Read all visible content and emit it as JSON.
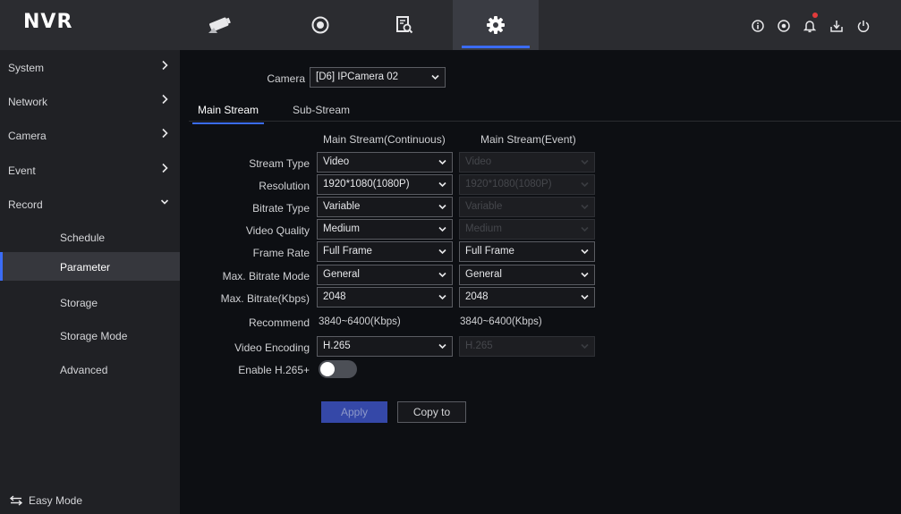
{
  "app": {
    "title": "NVR"
  },
  "topnav": {
    "tabs": [
      {
        "name": "live-view",
        "icon": "camera-icon"
      },
      {
        "name": "playback",
        "icon": "playback-icon"
      },
      {
        "name": "file-management",
        "icon": "file-search-icon"
      },
      {
        "name": "configuration",
        "icon": "gear-icon",
        "active": true
      }
    ],
    "right_icons": [
      "info-icon",
      "record-status-icon",
      "bell-icon",
      "download-icon",
      "power-icon"
    ]
  },
  "sidebar": {
    "items": [
      {
        "label": "System",
        "expandable": true
      },
      {
        "label": "Network",
        "expandable": true
      },
      {
        "label": "Camera",
        "expandable": true
      },
      {
        "label": "Event",
        "expandable": true
      },
      {
        "label": "Record",
        "expandable": true,
        "expanded": true
      },
      {
        "label": "Schedule"
      },
      {
        "label": "Parameter",
        "active": true
      },
      {
        "label": "Storage"
      },
      {
        "label": "Storage Mode"
      },
      {
        "label": "Advanced"
      }
    ],
    "easy_mode_label": "Easy Mode"
  },
  "camera": {
    "label": "Camera",
    "value": "[D6] IPCamera 02"
  },
  "tabs": [
    {
      "label": "Main Stream",
      "active": true
    },
    {
      "label": "Sub-Stream"
    }
  ],
  "columns": {
    "continuous": "Main Stream(Continuous)",
    "event": "Main Stream(Event)"
  },
  "rows": {
    "stream_type": {
      "label": "Stream Type",
      "continuous": "Video",
      "event": "Video"
    },
    "resolution": {
      "label": "Resolution",
      "continuous": "1920*1080(1080P)",
      "event": "1920*1080(1080P)"
    },
    "bitrate_type": {
      "label": "Bitrate Type",
      "continuous": "Variable",
      "event": "Variable"
    },
    "video_quality": {
      "label": "Video Quality",
      "continuous": "Medium",
      "event": "Medium"
    },
    "frame_rate": {
      "label": "Frame Rate",
      "continuous": "Full Frame",
      "event": "Full Frame"
    },
    "max_bitrate_mode": {
      "label": "Max. Bitrate Mode",
      "continuous": "General",
      "event": "General"
    },
    "max_bitrate": {
      "label": "Max. Bitrate(Kbps)",
      "continuous": "2048",
      "event": "2048"
    },
    "recommend": {
      "label": "Recommend",
      "continuous": "3840~6400(Kbps)",
      "event": "3840~6400(Kbps)"
    },
    "video_encoding": {
      "label": "Video Encoding",
      "continuous": "H.265",
      "event": "H.265"
    },
    "enable_h265plus": {
      "label": "Enable H.265+",
      "enabled": false
    }
  },
  "buttons": {
    "apply": "Apply",
    "copy_to": "Copy to"
  },
  "colors": {
    "accent": "#3b6cf6",
    "topbar": "#2b2c30",
    "sidebar": "#202125",
    "background": "#0d0f13",
    "notification": "#e23b3b"
  }
}
